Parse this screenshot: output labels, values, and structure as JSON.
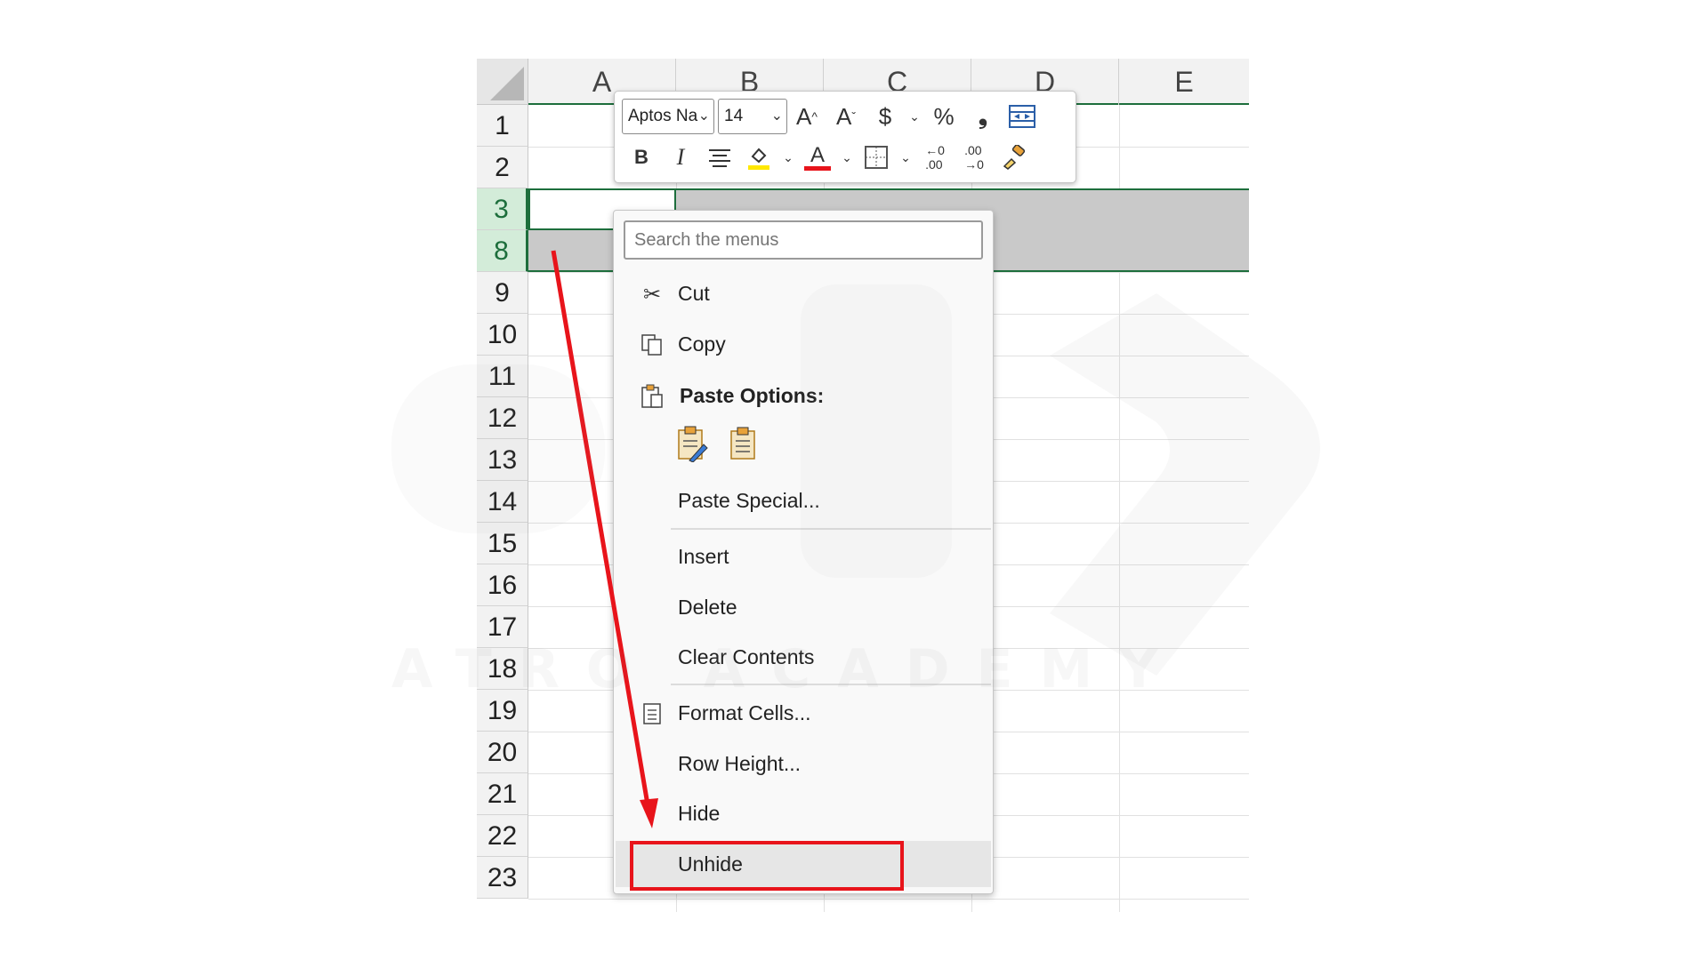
{
  "sheet": {
    "columns": [
      "A",
      "B",
      "C",
      "D",
      "E"
    ],
    "rows": [
      "1",
      "2",
      "3",
      "8",
      "9",
      "10",
      "11",
      "12",
      "13",
      "14",
      "15",
      "16",
      "17",
      "18",
      "19",
      "20",
      "21",
      "22",
      "23"
    ],
    "selected_rows": [
      "3",
      "8"
    ],
    "accent_color": "#1d6e3c"
  },
  "mini_toolbar": {
    "font_name": "Aptos Na",
    "font_size": "14",
    "grow_font_icon": "font-size-increase-icon",
    "shrink_font_icon": "font-size-decrease-icon",
    "currency_icon": "dollar-icon",
    "percent_icon": "percent-icon",
    "comma_icon": "comma-style-icon",
    "merge_icon": "merge-center-icon",
    "bold": "B",
    "italic": "I",
    "font_color_letter": "A",
    "fill_color": "#ffe800",
    "font_color": "#e8141b"
  },
  "context_menu": {
    "search_placeholder": "Search the menus",
    "items": [
      {
        "label": "Cut",
        "icon": "scissors-icon"
      },
      {
        "label": "Copy",
        "icon": "copy-icon"
      },
      {
        "label": "Paste Options:",
        "icon": "clipboard-icon"
      },
      {
        "label": "Paste Special...",
        "icon": ""
      },
      {
        "label": "Insert",
        "icon": ""
      },
      {
        "label": "Delete",
        "icon": ""
      },
      {
        "label": "Clear Contents",
        "icon": ""
      },
      {
        "label": "Format Cells...",
        "icon": "format-cells-icon"
      },
      {
        "label": "Row Height...",
        "icon": ""
      },
      {
        "label": "Hide",
        "icon": ""
      },
      {
        "label": "Unhide",
        "icon": ""
      }
    ],
    "highlight_color": "#e8141b"
  },
  "watermark_text": "ATRO ACADEMY"
}
